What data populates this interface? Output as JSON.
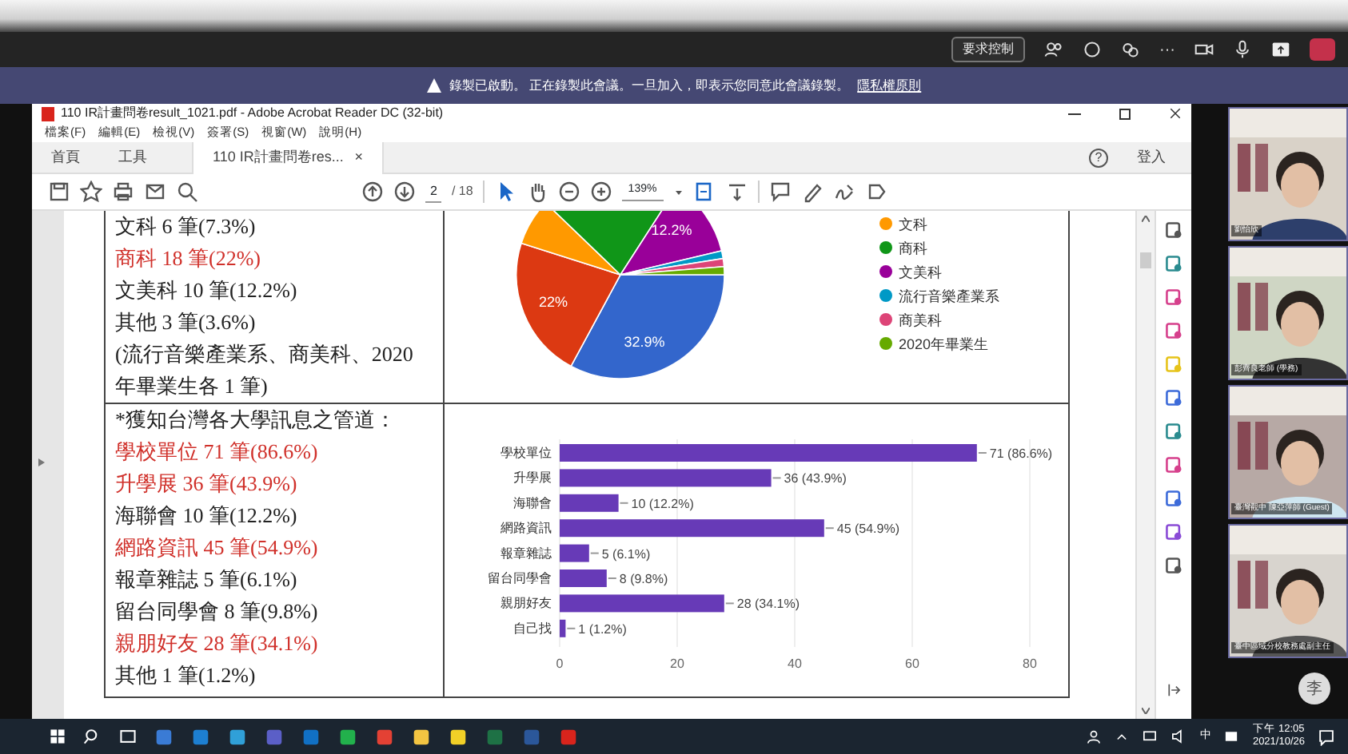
{
  "meeting_bar": {
    "control_button": "要求控制",
    "more_label": "···"
  },
  "banner": {
    "text": "錄製已啟動。 正在錄製此會議。一旦加入，即表示您同意此會議錄製。",
    "link": "隱私權原則"
  },
  "reader": {
    "title": "110 IR計畫問卷result_1021.pdf - Adobe Acrobat Reader DC (32-bit)",
    "menu": [
      "檔案(F)",
      "編輯(E)",
      "檢視(V)",
      "簽署(S)",
      "視窗(W)",
      "說明(H)"
    ],
    "tabs": [
      {
        "label": "首頁",
        "selected": false
      },
      {
        "label": "工具",
        "selected": false
      },
      {
        "label": "110 IR計畫問卷res...",
        "selected": true,
        "close": "×"
      }
    ],
    "help": "?",
    "sign_in": "登入",
    "page_number": "2",
    "page_total": "/ 18",
    "zoom": "139%"
  },
  "document": {
    "row_1_lines": [
      {
        "text": "文科  6 筆(7.3%)",
        "highlight": false
      },
      {
        "text": "商科  18 筆(22%)",
        "highlight": true
      },
      {
        "text": "文美科  10 筆(12.2%)",
        "highlight": false
      },
      {
        "text": "其他  3 筆(3.6%)",
        "highlight": false
      },
      {
        "text": "(流行音樂產業系、商美科、2020",
        "highlight": false
      },
      {
        "text": "年畢業生各 1 筆)",
        "highlight": false
      }
    ],
    "pie": {
      "slice_labels": [
        "12.2%",
        "22%",
        "32.9%"
      ],
      "legend": [
        {
          "label": "文科",
          "color": "#ff9900"
        },
        {
          "label": "商科",
          "color": "#109618"
        },
        {
          "label": "文美科",
          "color": "#990099"
        },
        {
          "label": "流行音樂產業系",
          "color": "#0099c6"
        },
        {
          "label": "商美科",
          "color": "#dd4477"
        },
        {
          "label": "2020年畢業生",
          "color": "#66aa00"
        }
      ]
    },
    "row_2_lines": [
      {
        "text": "*獲知台灣各大學訊息之管道：",
        "highlight": false
      },
      {
        "text": "學校單位 71 筆(86.6%)",
        "highlight": true
      },
      {
        "text": "升學展 36 筆(43.9%)",
        "highlight": true
      },
      {
        "text": "海聯會 10 筆(12.2%)",
        "highlight": false
      },
      {
        "text": "網路資訊 45 筆(54.9%)",
        "highlight": true
      },
      {
        "text": "報章雜誌 5 筆(6.1%)",
        "highlight": false
      },
      {
        "text": "留台同學會 8 筆(9.8%)",
        "highlight": false
      },
      {
        "text": "親朋好友 28 筆(34.1%)",
        "highlight": true
      },
      {
        "text": "其他 1 筆(1.2%)",
        "highlight": false
      }
    ],
    "chart_data": {
      "type": "bar",
      "orientation": "horizontal",
      "categories": [
        "學校單位",
        "升學展",
        "海聯會",
        "網路資訊",
        "報章雜誌",
        "留台同學會",
        "親朋好友",
        "自己找"
      ],
      "series": [
        {
          "color": "#673ab7",
          "values": [
            71,
            36,
            10,
            45,
            5,
            8,
            28,
            1
          ]
        }
      ],
      "grid": true,
      "xlim": [
        0,
        80
      ],
      "xticks": [
        0,
        20,
        40,
        60,
        80
      ],
      "value_labels": [
        "71 (86.6%)",
        "36 (43.9%)",
        "10 (12.2%)",
        "45 (54.9%)",
        "5 (6.1%)",
        "8 (9.8%)",
        "28 (34.1%)",
        "1 (1.2%)"
      ]
    }
  },
  "participants": [
    {
      "name": "劉怡欣"
    },
    {
      "name": "彭齊良老師 (學務)"
    },
    {
      "name": "臺灣觀中 陳亞萍師 (Guest)"
    },
    {
      "name": "臺中區域分校教務處副主任"
    }
  ],
  "avatar": "李",
  "taskbar": {
    "time": "下午 12:05",
    "date": "2021/10/26",
    "ime": "中"
  }
}
